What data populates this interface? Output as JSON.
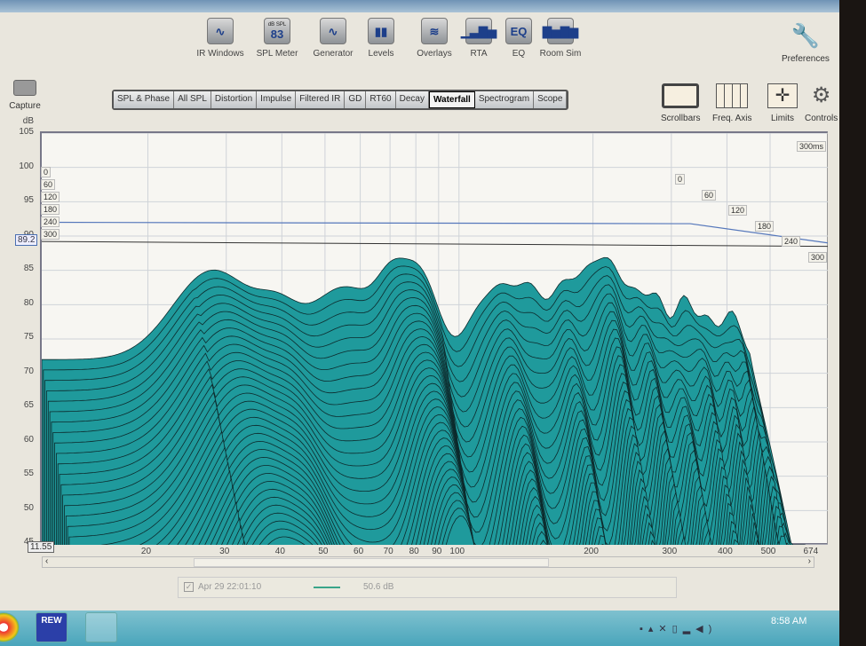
{
  "toolbar": {
    "items": [
      {
        "label": "IR Windows",
        "icon": "ir-windows-icon",
        "glyph": "∿"
      },
      {
        "label": "SPL Meter",
        "icon": "spl-meter-icon",
        "glyph": "83",
        "sub": "dB SPL"
      },
      {
        "label": "Generator",
        "icon": "generator-icon",
        "glyph": "∿"
      },
      {
        "label": "Levels",
        "icon": "levels-icon",
        "glyph": "▮▮"
      },
      {
        "label": "Overlays",
        "icon": "overlays-icon",
        "glyph": "≋"
      },
      {
        "label": "RTA",
        "icon": "rta-icon",
        "glyph": "▁▃▇▅"
      },
      {
        "label": "EQ",
        "icon": "eq-icon",
        "glyph": "EQ"
      },
      {
        "label": "Room Sim",
        "icon": "room-sim-icon",
        "glyph": "▇▅▇▆"
      }
    ],
    "preferences": "Preferences",
    "capture": "Capture"
  },
  "tabs": [
    "SPL & Phase",
    "All SPL",
    "Distortion",
    "Impulse",
    "Filtered IR",
    "GD",
    "RT60",
    "Decay",
    "Waterfall",
    "Spectrogram",
    "Scope"
  ],
  "active_tab": "Waterfall",
  "right_tools": [
    "Scrollbars",
    "Freq. Axis",
    "Limits",
    "Controls"
  ],
  "graph": {
    "y_unit": "dB",
    "y_ticks": [
      "105",
      "100",
      "95",
      "90",
      "85",
      "80",
      "75",
      "70",
      "65",
      "60",
      "55",
      "50",
      "45"
    ],
    "x_ticks": [
      "20",
      "30",
      "40",
      "50",
      "60",
      "70",
      "80",
      "90",
      "100",
      "200",
      "300",
      "400",
      "500"
    ],
    "x_unit_end": "674 Hz",
    "x_start": "11.55",
    "cursor_readout": "89.2",
    "time_labels": [
      "0",
      "60",
      "120",
      "180",
      "240",
      "300"
    ],
    "time_end": "300ms"
  },
  "legend": {
    "checked": true,
    "name": "Apr 29 22:01:10",
    "value": "50.6 dB",
    "color": "#3aa58a"
  },
  "taskbar": {
    "apps": [
      "Chrome",
      "REW",
      "Desktop"
    ],
    "rew_label": "REW",
    "clock": "8:58 AM"
  },
  "colors": {
    "surface": "#1f9a9c",
    "edge": "#0d2a2c"
  }
}
